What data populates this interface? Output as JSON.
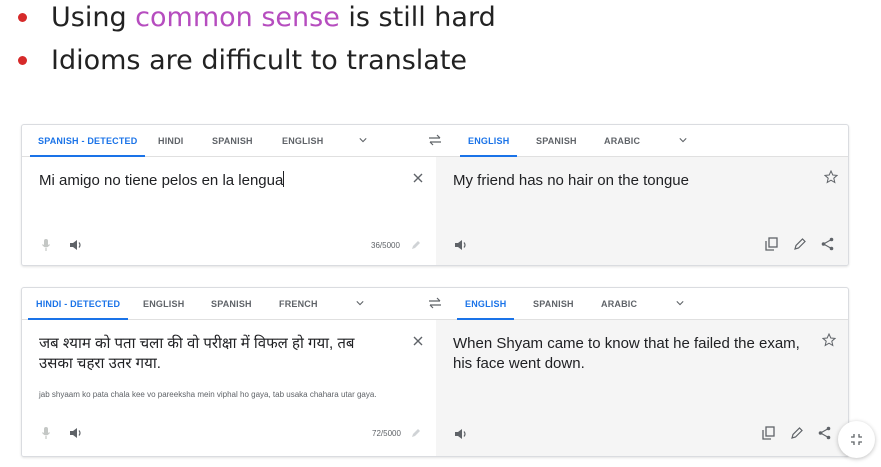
{
  "slide": {
    "bullets": [
      {
        "before": "Using ",
        "highlight": "common sense",
        "after": " is still hard"
      },
      {
        "before": "Idioms are difficult to translate",
        "highlight": "",
        "after": ""
      }
    ]
  },
  "widgets": [
    {
      "source_tabs": [
        "SPANISH - DETECTED",
        "HINDI",
        "SPANISH",
        "ENGLISH"
      ],
      "target_tabs": [
        "ENGLISH",
        "SPANISH",
        "ARABIC"
      ],
      "source_text": "Mi amigo no tiene pelos en la lengua",
      "transliteration": "",
      "char_count": "36/5000",
      "translation": "My friend has no hair on the tongue"
    },
    {
      "source_tabs": [
        "HINDI - DETECTED",
        "ENGLISH",
        "SPANISH",
        "FRENCH"
      ],
      "target_tabs": [
        "ENGLISH",
        "SPANISH",
        "ARABIC"
      ],
      "source_text": "जब श्याम को पता चला की वो परीक्षा में विफल हो गया, तब उसका चहरा उतर गया.",
      "transliteration": "jab shyaam ko pata chala kee vo pareeksha mein viphal ho gaya, tab usaka chahara utar gaya.",
      "char_count": "72/5000",
      "translation": "When Shyam came to know that he failed the exam, his face went down."
    }
  ],
  "colors": {
    "accent": "#1a73e8",
    "bullet": "#d62a2a",
    "highlight": "#b64dbf",
    "target_pane": "#f5f5f5"
  }
}
